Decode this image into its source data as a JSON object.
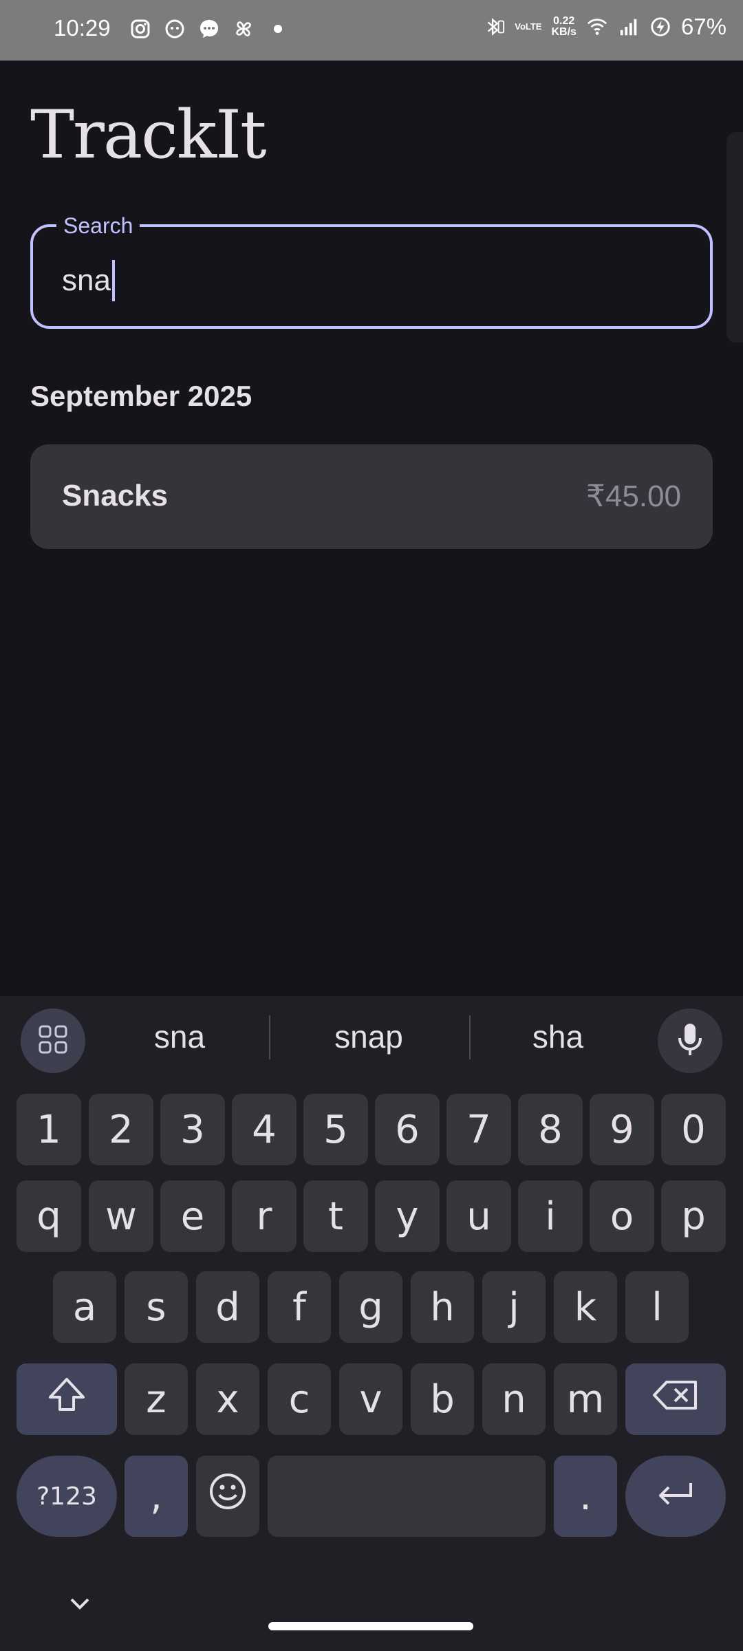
{
  "status_bar": {
    "time": "10:29",
    "data_speed_value": "0.22",
    "data_speed_unit": "KB/s",
    "network_label_top": "VoLTE",
    "battery": "67%"
  },
  "app": {
    "title": "TrackIt",
    "search": {
      "label": "Search",
      "value": "sna"
    },
    "month_header": "September 2025",
    "expenses": [
      {
        "name": "Snacks",
        "amount": "₹45.00"
      }
    ]
  },
  "keyboard": {
    "suggestions": [
      "sna",
      "snap",
      "sha"
    ],
    "row_numbers": [
      "1",
      "2",
      "3",
      "4",
      "5",
      "6",
      "7",
      "8",
      "9",
      "0"
    ],
    "row1": [
      "q",
      "w",
      "e",
      "r",
      "t",
      "y",
      "u",
      "i",
      "o",
      "p"
    ],
    "row2": [
      "a",
      "s",
      "d",
      "f",
      "g",
      "h",
      "j",
      "k",
      "l"
    ],
    "row3": [
      "z",
      "x",
      "c",
      "v",
      "b",
      "n",
      "m"
    ],
    "symbols_key": "?123",
    "comma_key": ",",
    "period_key": "."
  },
  "colors": {
    "background": "#14141a",
    "accent": "#c2c1ff",
    "card": "#35343b",
    "status_bar": "#7c7c7c"
  }
}
